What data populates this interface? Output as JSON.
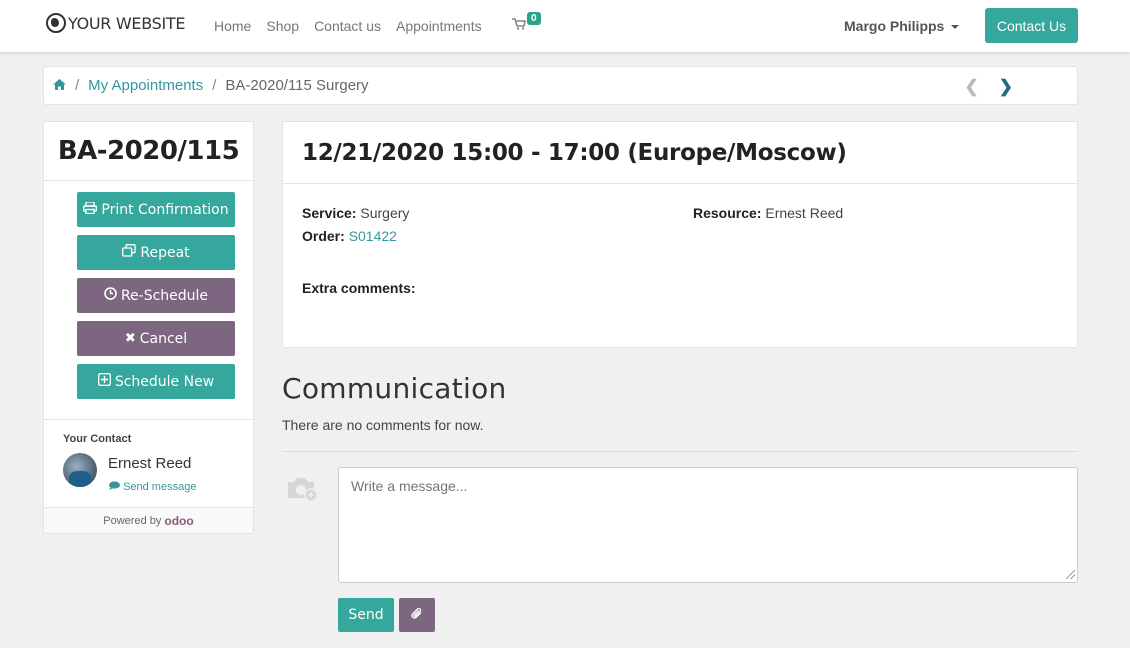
{
  "navbar": {
    "brand": "YOUR WEBSITE",
    "links": [
      "Home",
      "Shop",
      "Contact us",
      "Appointments"
    ],
    "cart_count": "0",
    "user": "Margo Philipps",
    "contact_button": "Contact Us"
  },
  "breadcrumb": {
    "items": [
      "My Appointments",
      "BA-2020/115 Surgery"
    ]
  },
  "sidebar": {
    "title": "BA-2020/115",
    "buttons": {
      "print": "Print Confirmation",
      "repeat": "Repeat",
      "reschedule": "Re-Schedule",
      "cancel": "Cancel",
      "schedule_new": "Schedule New"
    },
    "contact_label": "Your Contact",
    "contact_name": "Ernest Reed",
    "send_message": "Send message",
    "powered_by": "Powered by",
    "powered_brand": "odoo"
  },
  "appointment": {
    "header": "12/21/2020 15:00 - 17:00 (Europe/Moscow)",
    "service_label": "Service:",
    "service": "Surgery",
    "order_label": "Order:",
    "order": "S01422",
    "resource_label": "Resource:",
    "resource": "Ernest Reed",
    "extra_comments_label": "Extra comments:"
  },
  "communication": {
    "title": "Communication",
    "empty_text": "There are no comments for now.",
    "placeholder": "Write a message...",
    "send": "Send"
  },
  "colors": {
    "teal": "#35a79c",
    "purple": "#7c6680",
    "link": "#35979c"
  }
}
